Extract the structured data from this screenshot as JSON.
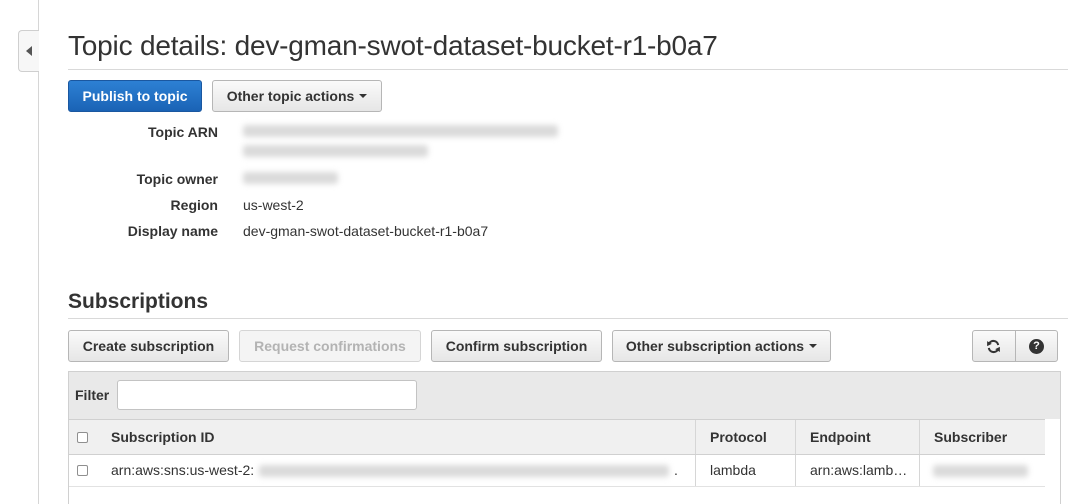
{
  "header": {
    "title": "Topic details: dev-gman-swot-dataset-bucket-r1-b0a7",
    "collapse_icon": "chevron-left-icon"
  },
  "actions": {
    "publish_label": "Publish to topic",
    "other_actions_label": "Other topic actions"
  },
  "details": {
    "arn_label": "Topic ARN",
    "owner_label": "Topic owner",
    "region_label": "Region",
    "region_value": "us-west-2",
    "display_name_label": "Display name",
    "display_name_value": "dev-gman-swot-dataset-bucket-r1-b0a7"
  },
  "subscriptions": {
    "title": "Subscriptions",
    "buttons": {
      "create": "Create subscription",
      "request_confirmations": "Request confirmations",
      "confirm": "Confirm subscription",
      "other_actions": "Other subscription actions",
      "refresh_icon": "refresh-icon",
      "help_icon": "help-icon",
      "help_glyph": "?"
    },
    "filter": {
      "label": "Filter",
      "value": ""
    },
    "table": {
      "headers": [
        "Subscription ID",
        "Protocol",
        "Endpoint",
        "Subscriber"
      ],
      "rows": [
        {
          "subscription_id": "arn:aws:sns:us-west-2:",
          "protocol": "lambda",
          "endpoint": "arn:aws:lamb…"
        }
      ]
    }
  },
  "colors": {
    "primary": "#1f6fc5",
    "text": "#333333",
    "border": "#d0d0d0"
  }
}
